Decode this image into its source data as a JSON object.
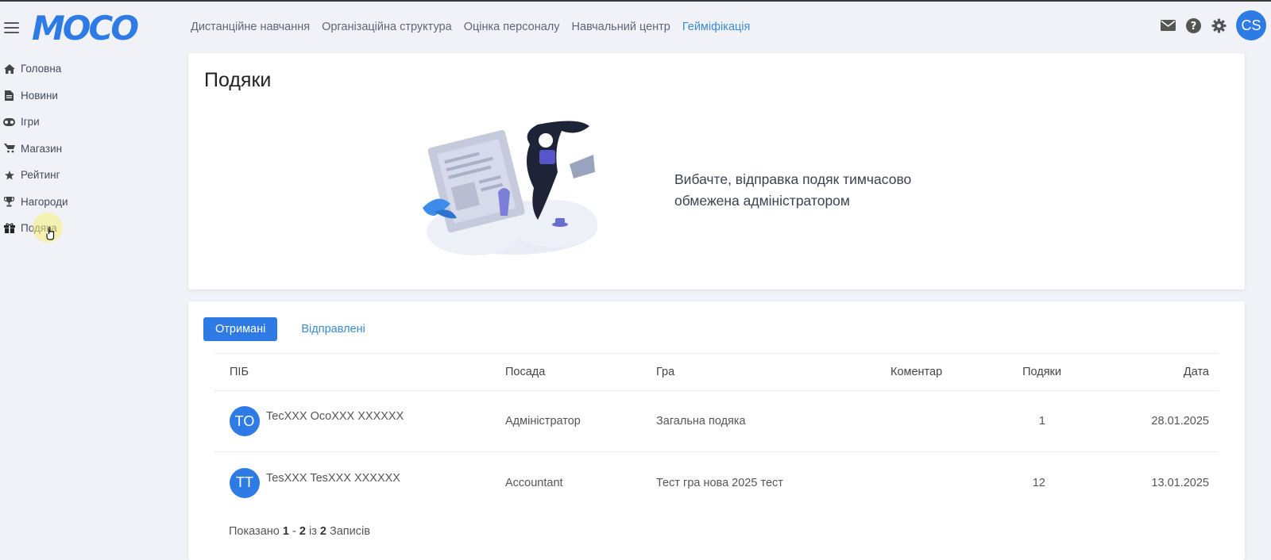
{
  "app": {
    "logo": "MOCO"
  },
  "nav": [
    {
      "label": "Дистанційне навчання",
      "active": false
    },
    {
      "label": "Організаційна структура",
      "active": false
    },
    {
      "label": "Оцінка персоналу",
      "active": false
    },
    {
      "label": "Навчальний центр",
      "active": false
    },
    {
      "label": "Гейміфікація",
      "active": true
    }
  ],
  "user": {
    "initials": "CS"
  },
  "sidebar": {
    "items": [
      {
        "label": "Головна",
        "icon": "home-icon"
      },
      {
        "label": "Новини",
        "icon": "file-icon"
      },
      {
        "label": "Ігри",
        "icon": "gamepad-icon"
      },
      {
        "label": "Магазин",
        "icon": "cart-icon"
      },
      {
        "label": "Рейтинг",
        "icon": "star-icon"
      },
      {
        "label": "Нагороди",
        "icon": "trophy-icon"
      },
      {
        "label": "Подяка",
        "icon": "gift-icon"
      }
    ]
  },
  "page": {
    "title": "Подяки",
    "notice": "Вибачте, відправка подяк тимчасово обмежена адміністратором"
  },
  "tabs": {
    "received": "Отримані",
    "sent": "Відправлені"
  },
  "table": {
    "headers": {
      "name": "ПІБ",
      "position": "Посада",
      "game": "Гра",
      "comment": "Коментар",
      "count": "Подяки",
      "date": "Дата"
    },
    "rows": [
      {
        "initials": "TO",
        "name": "TecXXX OcoXXX XXXXXX",
        "position": "Адміністратор",
        "game": "Загальна подяка",
        "comment": "",
        "count": "1",
        "date": "28.01.2025"
      },
      {
        "initials": "TT",
        "name": "TesXXX TesXXX XXXXXX",
        "position": "Accountant",
        "game": "Тест гра нова 2025 тест",
        "comment": "",
        "count": "12",
        "date": "13.01.2025"
      }
    ]
  },
  "pagination": {
    "prefix": "Показано",
    "from": "1",
    "dash": "-",
    "to": "2",
    "of": "із",
    "total": "2",
    "suffix": "Записів"
  },
  "colors": {
    "accent": "#2f7be5",
    "link": "#3a8bd0"
  }
}
